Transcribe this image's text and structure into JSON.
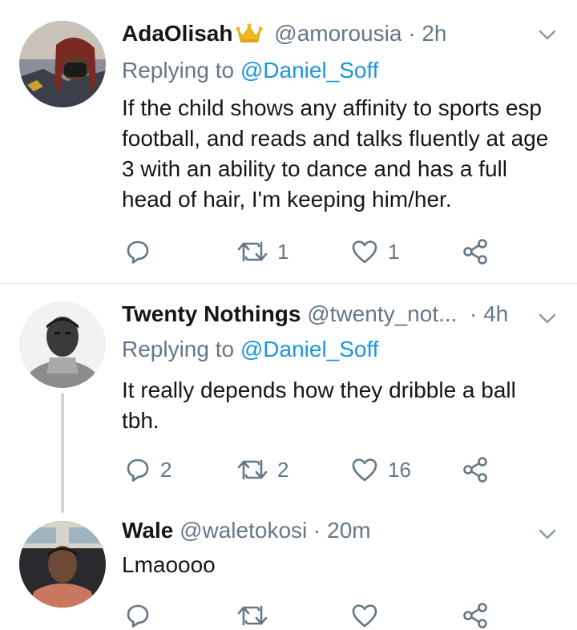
{
  "tweets": [
    {
      "name": "AdaOlisah",
      "handle": "@amorousia",
      "sep": "·",
      "time": "2h",
      "replying_prefix": "Replying to ",
      "replying_to": "@Daniel_Soff",
      "text": "If the child shows any affinity to sports esp football, and reads and talks fluently at age 3 with an ability to dance and has a full head of hair, I'm keeping him/her.",
      "replies": "",
      "retweets": "1",
      "likes": "1"
    },
    {
      "name": "Twenty Nothings",
      "handle": "@twenty_not...",
      "sep": "·",
      "time": "4h",
      "replying_prefix": "Replying to ",
      "replying_to": "@Daniel_Soff",
      "text": "It really depends how they dribble a ball tbh.",
      "replies": "2",
      "retweets": "2",
      "likes": "16"
    },
    {
      "name": "Wale",
      "handle": "@waletokosi",
      "sep": "·",
      "time": "20m",
      "text": "Lmaoooo",
      "replies": "",
      "retweets": "",
      "likes": ""
    }
  ],
  "colors": {
    "text": "#14171a",
    "secondary": "#657786",
    "link": "#1b95e0",
    "divider": "#e1e8ed",
    "thread_line": "#ccd6dd"
  },
  "icons": [
    "crown-emoji-icon",
    "chevron-down-icon",
    "reply-icon",
    "retweet-icon",
    "like-icon",
    "share-icon"
  ]
}
